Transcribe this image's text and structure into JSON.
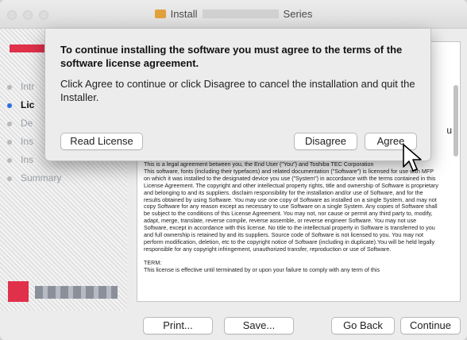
{
  "window": {
    "title_prefix": "Install",
    "title_suffix": "Series"
  },
  "sidebar": {
    "steps": [
      {
        "label": "Intr",
        "active": false
      },
      {
        "label": "Lic",
        "active": true
      },
      {
        "label": "De",
        "active": false
      },
      {
        "label": "Ins",
        "active": false
      },
      {
        "label": "Ins",
        "active": false
      },
      {
        "label": "Summary",
        "active": false
      }
    ]
  },
  "license": {
    "peek_char": "u",
    "intro_line": "This is a legal agreement between you, the End User (\"You\") and Toshiba TEC Corporation",
    "p1": "This software, fonts (including their typefaces) and related documentation (\"Software\") is licensed for use with MFP on which it was installed to the designated device you use (\"System\") in accordance with the terms contained in this License Agreement. The copyright and other intellectual property rights, title and ownership of Software is proprietary and belonging to and its suppliers. disclaim responsibility for the installation and/or use of Software, and for the results obtained by using Software. You may use one copy of Software as installed on a single System, and may not copy Software for any reason except as necessary to use Software on a single System. Any copies of Software shall be subject to the conditions of this License Agreement. You may not, nor cause or permit any third party to, modify, adapt, merge, translate, reverse compile, reverse assemble, or reverse engineer Software. You may not use Software, except in accordance with this license. No title to the intellectual property in Software is transferred to you and full ownership is retained by and its suppliers. Source code of Software is not licensed to you. You may not perform modification, deletion, etc to the copyright notice of Software (including in duplicate).You will be held legally responsible for any copyright infringement, unauthorized transfer, reproduction or use of Software.",
    "term_heading": "TERM:",
    "term_text": "This license is effective until terminated by or upon your failure to comply with any term of this"
  },
  "bottom": {
    "print": "Print...",
    "save": "Save...",
    "go_back": "Go Back",
    "continue": "Continue"
  },
  "sheet": {
    "heading": "To continue installing the software you must agree to the terms of the software license agreement.",
    "message": "Click Agree to continue or click Disagree to cancel the installation and quit the Installer.",
    "read_license": "Read License",
    "disagree": "Disagree",
    "agree": "Agree"
  },
  "colors": {
    "accent": "#2a6fe0",
    "brand": "#e0304a"
  }
}
